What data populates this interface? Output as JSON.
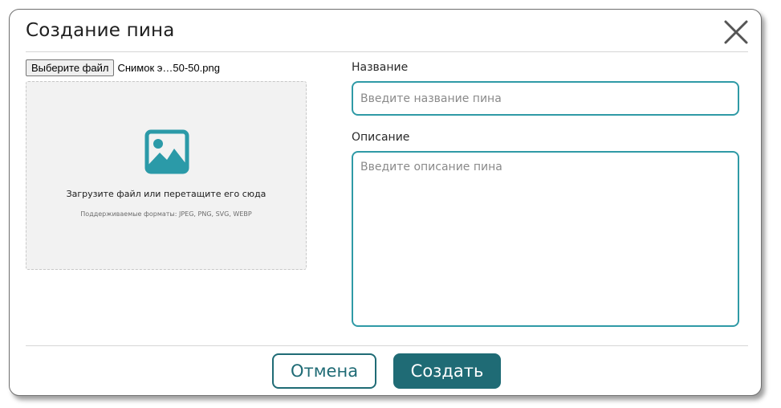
{
  "modal": {
    "title": "Создание пина",
    "close_icon": "close-icon"
  },
  "upload": {
    "choose_file_label": "Выберите файл",
    "file_name": "Снимок э…50-50.png",
    "dropzone_icon": "image-icon",
    "dropzone_text": "Загрузите файл или перетащите его сюда",
    "dropzone_hint": "Поддерживаемые форматы: JPEG, PNG, SVG, WEBP"
  },
  "form": {
    "name_label": "Название",
    "name_placeholder": "Введите название пина",
    "name_value": "",
    "description_label": "Описание",
    "description_placeholder": "Введите описание пина",
    "description_value": ""
  },
  "actions": {
    "cancel_label": "Отмена",
    "create_label": "Создать"
  },
  "colors": {
    "accent": "#1f6b75",
    "input_border": "#2f9aa6",
    "icon": "#2b9aa8"
  }
}
